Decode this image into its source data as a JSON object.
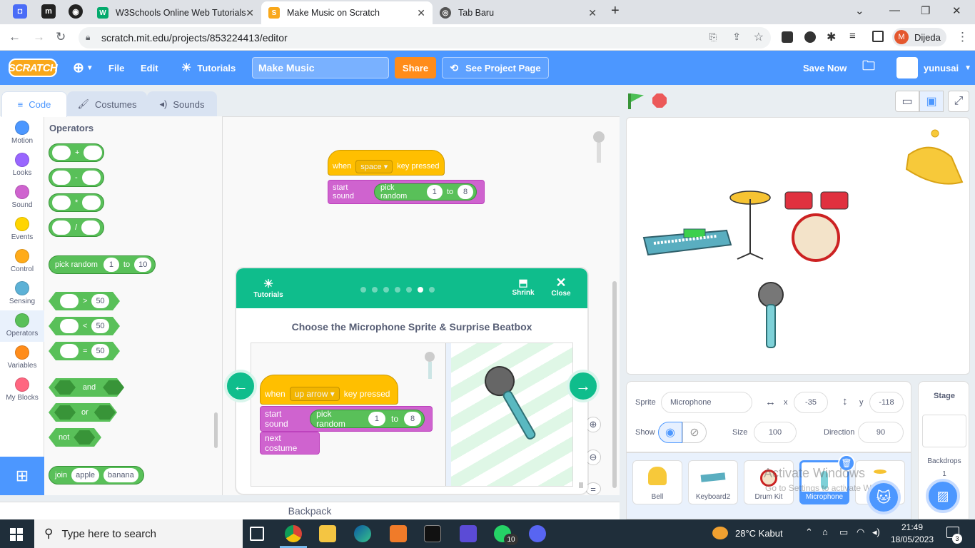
{
  "browser": {
    "tabs": [
      {
        "title": "W3Schools Online Web Tutorials"
      },
      {
        "title": "Make Music on Scratch"
      },
      {
        "title": "Tab Baru"
      }
    ],
    "url": "scratch.mit.edu/projects/853224413/editor",
    "profile_name": "Dijeda",
    "profile_initial": "M"
  },
  "menubar": {
    "logo": "SCRATCH",
    "file": "File",
    "edit": "Edit",
    "tutorials": "Tutorials",
    "project_title": "Make Music",
    "share": "Share",
    "see_project": "See Project Page",
    "save_now": "Save Now",
    "username": "yunusai"
  },
  "editor_tabs": {
    "code": "Code",
    "costumes": "Costumes",
    "sounds": "Sounds"
  },
  "categories": [
    {
      "label": "Motion",
      "color": "#4c97ff"
    },
    {
      "label": "Looks",
      "color": "#9966ff"
    },
    {
      "label": "Sound",
      "color": "#cf63cf"
    },
    {
      "label": "Events",
      "color": "#ffd500"
    },
    {
      "label": "Control",
      "color": "#ffab19"
    },
    {
      "label": "Sensing",
      "color": "#5cb1d6"
    },
    {
      "label": "Operators",
      "color": "#59c059"
    },
    {
      "label": "Variables",
      "color": "#ff8c1a"
    },
    {
      "label": "My Blocks",
      "color": "#ff6680"
    }
  ],
  "palette": {
    "heading": "Operators",
    "ops": [
      "+",
      "-",
      "*",
      "/"
    ],
    "pick_random": {
      "label": "pick random",
      "from": "1",
      "to_label": "to",
      "to": "10"
    },
    "compare": [
      {
        "op": ">",
        "val": "50"
      },
      {
        "op": "<",
        "val": "50"
      },
      {
        "op": "=",
        "val": "50"
      }
    ],
    "and": "and",
    "or": "or",
    "not": "not",
    "join": {
      "label": "join",
      "a": "apple",
      "b": "banana"
    }
  },
  "workspace_script": {
    "when": "when",
    "key": "space",
    "key_pressed": "key pressed",
    "start_sound": "start sound",
    "pick_random": "pick random",
    "from": "1",
    "to_label": "to",
    "to": "8"
  },
  "backpack": "Backpack",
  "tutorial": {
    "tutorials_label": "Tutorials",
    "shrink": "Shrink",
    "close": "Close",
    "title": "Choose the Microphone Sprite & Surprise Beatbox",
    "step_total": 7,
    "step_current": 6,
    "script": {
      "when": "when",
      "key": "up arrow",
      "key_pressed": "key pressed",
      "start_sound": "start sound",
      "pick_random": "pick random",
      "from": "1",
      "to_label": "to",
      "to": "8",
      "next_costume": "next costume"
    }
  },
  "sprite_info": {
    "sprite_label": "Sprite",
    "sprite_name": "Microphone",
    "x_label": "x",
    "x": "-35",
    "y_label": "y",
    "y": "-118",
    "show_label": "Show",
    "size_label": "Size",
    "size": "100",
    "direction_label": "Direction",
    "direction": "90"
  },
  "sprites": [
    {
      "name": "Bell"
    },
    {
      "name": "Keyboard2"
    },
    {
      "name": "Drum Kit"
    },
    {
      "name": "Microphone"
    },
    {
      "name": "Dr..."
    }
  ],
  "stage_panel": {
    "title": "Stage",
    "backdrops_label": "Backdrops",
    "backdrops_count": "1"
  },
  "watermark": {
    "line1": "Activate Windows",
    "line2": "Go to Settings to activate Windows."
  },
  "taskbar": {
    "search_placeholder": "Type here to search",
    "weather": "28°C  Kabut",
    "time": "21:49",
    "date": "18/05/2023",
    "whatsapp_badge": "10",
    "notif_badge": "3"
  }
}
